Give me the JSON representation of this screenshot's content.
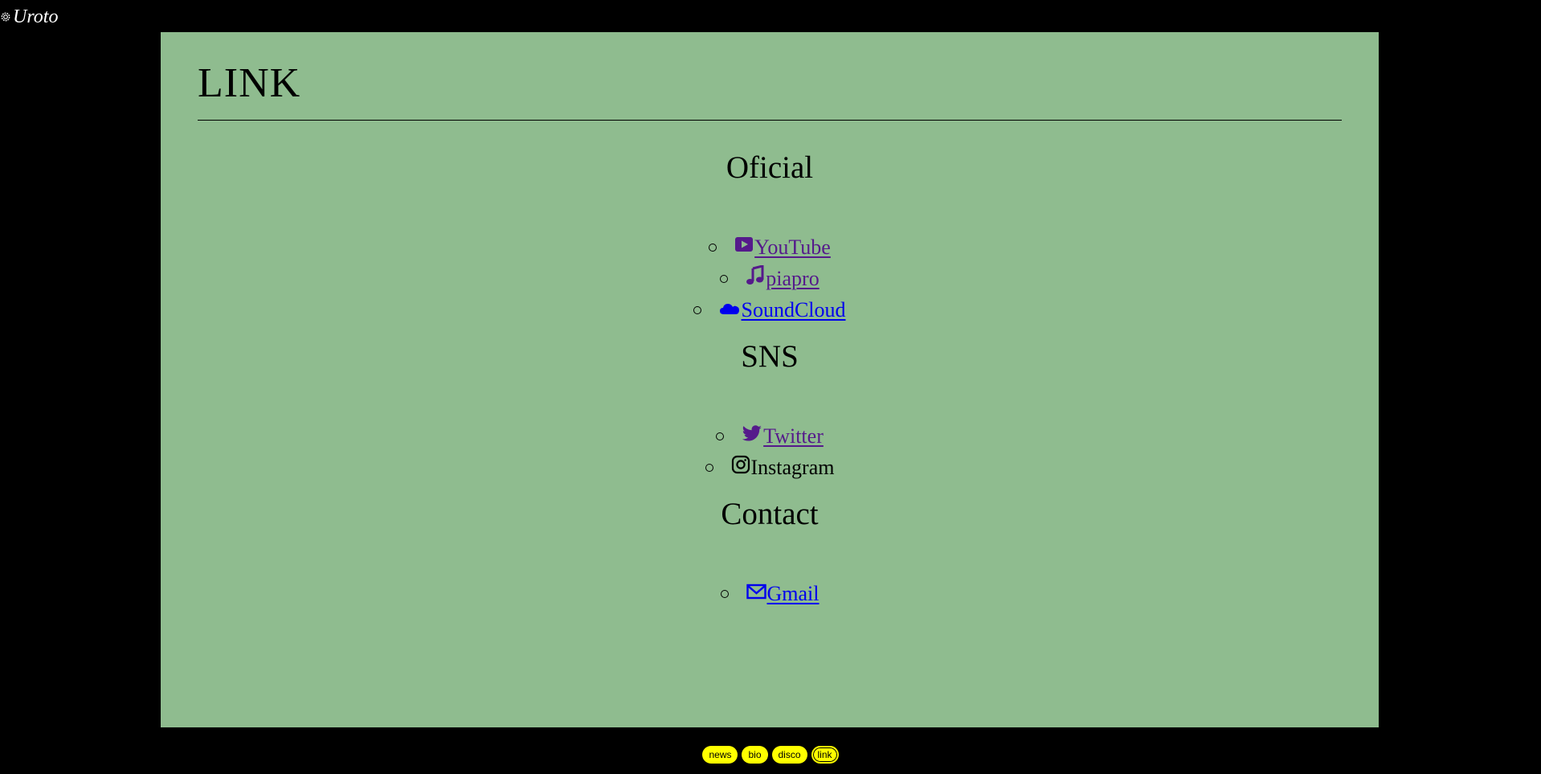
{
  "site": {
    "logo_text": "Uroto",
    "logo_icon": "gear-icon"
  },
  "page": {
    "title": "LINK"
  },
  "sections": [
    {
      "heading": "Oficial",
      "links": [
        {
          "label": "YouTube",
          "icon": "youtube-icon",
          "state": "visited"
        },
        {
          "label": "piapro",
          "icon": "music-note-icon",
          "state": "visited"
        },
        {
          "label": "SoundCloud",
          "icon": "cloud-icon",
          "state": "unvisited"
        }
      ]
    },
    {
      "heading": "SNS",
      "links": [
        {
          "label": "Twitter",
          "icon": "twitter-icon",
          "state": "visited"
        },
        {
          "label": "Instagram",
          "icon": "instagram-icon",
          "state": "plain"
        }
      ]
    },
    {
      "heading": "Contact",
      "links": [
        {
          "label": "Gmail",
          "icon": "envelope-icon",
          "state": "unvisited"
        }
      ]
    }
  ],
  "nav": {
    "items": [
      "news",
      "bio",
      "disco",
      "link"
    ],
    "active": "link"
  },
  "colors": {
    "background": "#000000",
    "panel": "#8fbc8f",
    "visited_link": "#551a8b",
    "unvisited_link": "#0000ee",
    "nav_pill": "#ffff00"
  }
}
